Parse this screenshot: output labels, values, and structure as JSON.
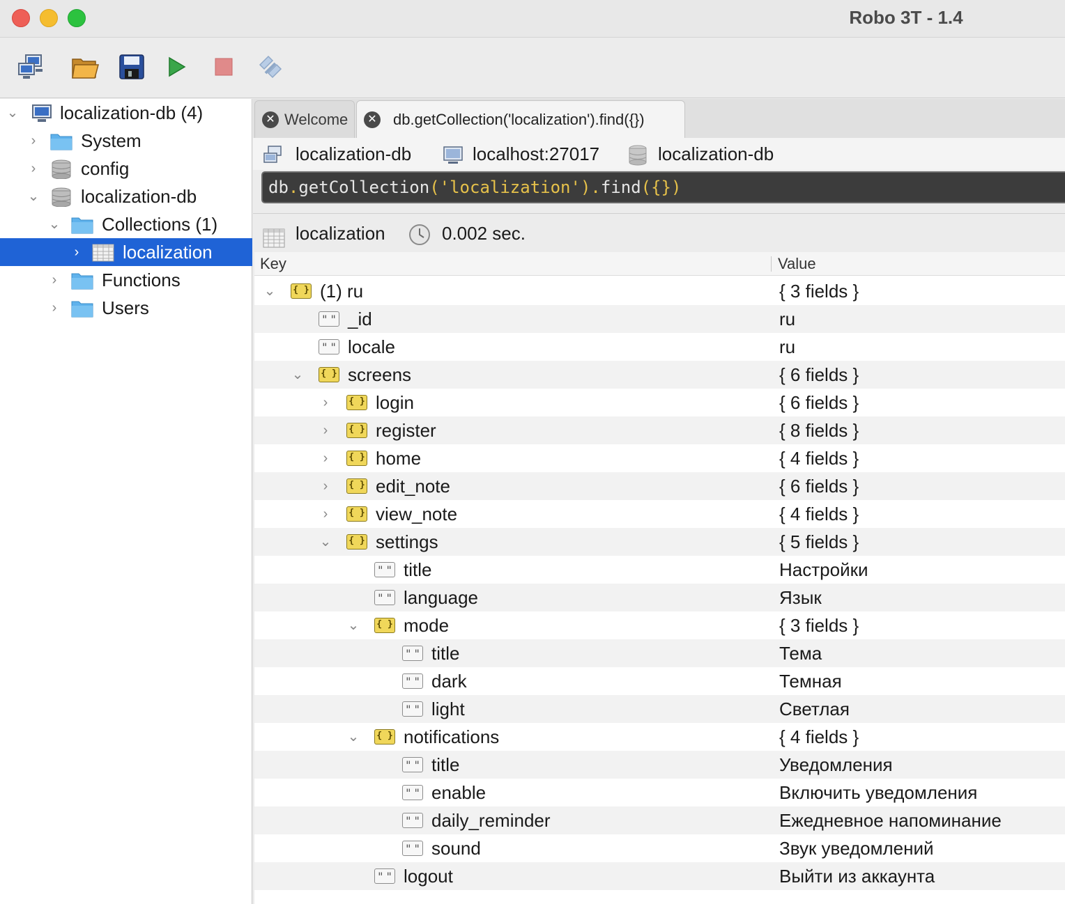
{
  "window": {
    "title": "Robo 3T - 1.4"
  },
  "toolbar": {
    "buttons": [
      "connect-icon",
      "open-icon",
      "save-icon",
      "run-icon",
      "stop-icon",
      "rotate-icon"
    ]
  },
  "sidebar": {
    "items": [
      {
        "label": "localization-db (4)",
        "icon": "server-icon"
      },
      {
        "label": "System",
        "icon": "folder-icon"
      },
      {
        "label": "config",
        "icon": "database-icon"
      },
      {
        "label": "localization-db",
        "icon": "database-icon"
      },
      {
        "label": "Collections (1)",
        "icon": "folder-icon"
      },
      {
        "label": "localization",
        "icon": "collection-icon"
      },
      {
        "label": "Functions",
        "icon": "folder-icon"
      },
      {
        "label": "Users",
        "icon": "folder-icon"
      }
    ]
  },
  "tabs": [
    {
      "label": "Welcome"
    },
    {
      "label": "db.getCollection('localization').find({})"
    }
  ],
  "connection": {
    "server": "localization-db",
    "host": "localhost:27017",
    "database": "localization-db"
  },
  "query": {
    "prefix": "db",
    "dot1": ".",
    "method": "getCollection",
    "open": "(",
    "arg": "'localization'",
    "close": ")",
    "dot2": ".",
    "find": "find",
    "braces": "({})"
  },
  "result": {
    "collection": "localization",
    "time": "0.002 sec."
  },
  "grid": {
    "headers": {
      "key": "Key",
      "value": "Value"
    },
    "rows": [
      {
        "key": "(1) ru",
        "value": "{ 3 fields }",
        "type": "object"
      },
      {
        "key": "_id",
        "value": "ru",
        "type": "string"
      },
      {
        "key": "locale",
        "value": "ru",
        "type": "string"
      },
      {
        "key": "screens",
        "value": "{ 6 fields }",
        "type": "object"
      },
      {
        "key": "login",
        "value": "{ 6 fields }",
        "type": "object"
      },
      {
        "key": "register",
        "value": "{ 8 fields }",
        "type": "object"
      },
      {
        "key": "home",
        "value": "{ 4 fields }",
        "type": "object"
      },
      {
        "key": "edit_note",
        "value": "{ 6 fields }",
        "type": "object"
      },
      {
        "key": "view_note",
        "value": "{ 4 fields }",
        "type": "object"
      },
      {
        "key": "settings",
        "value": "{ 5 fields }",
        "type": "object"
      },
      {
        "key": "title",
        "value": "Настройки",
        "type": "string"
      },
      {
        "key": "language",
        "value": "Язык",
        "type": "string"
      },
      {
        "key": "mode",
        "value": "{ 3 fields }",
        "type": "object"
      },
      {
        "key": "title",
        "value": "Тема",
        "type": "string"
      },
      {
        "key": "dark",
        "value": "Темная",
        "type": "string"
      },
      {
        "key": "light",
        "value": "Светлая",
        "type": "string"
      },
      {
        "key": "notifications",
        "value": "{ 4 fields }",
        "type": "object"
      },
      {
        "key": "title",
        "value": "Уведомления",
        "type": "string"
      },
      {
        "key": "enable",
        "value": "Включить уведомления",
        "type": "string"
      },
      {
        "key": "daily_reminder",
        "value": "Ежедневное напоминание",
        "type": "string"
      },
      {
        "key": "sound",
        "value": "Звук уведомлений",
        "type": "string"
      },
      {
        "key": "logout",
        "value": "Выйти из аккаунта",
        "type": "string"
      }
    ]
  }
}
